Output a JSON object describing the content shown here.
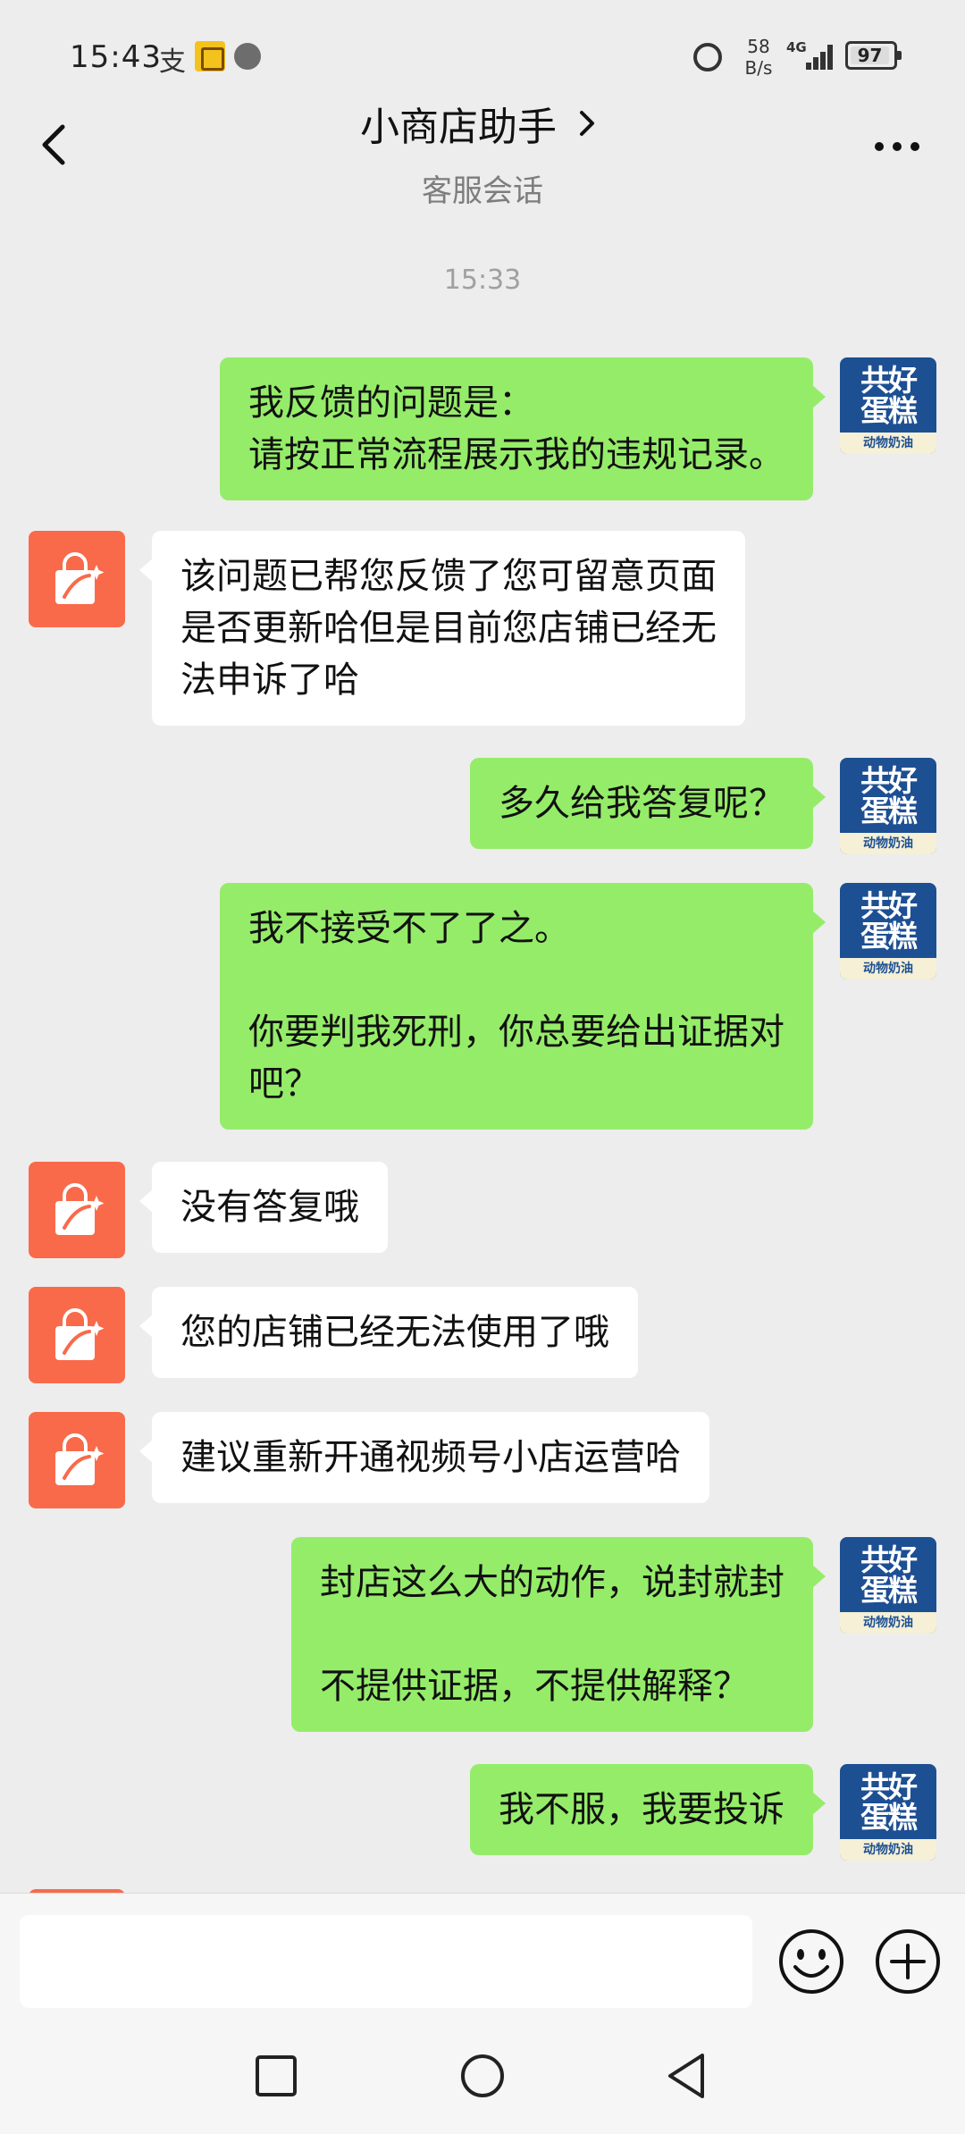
{
  "status_bar": {
    "time": "15:43",
    "alipay_glyph": "支",
    "net_speed_value": "58",
    "net_speed_unit": "B/s",
    "network_type": "4G",
    "battery": "97",
    "icons": [
      "alipay-icon",
      "app-badge-icon",
      "voice-icon",
      "alarm-icon",
      "signal-icon",
      "battery-icon"
    ]
  },
  "header": {
    "title": "小商店助手",
    "subtitle": "客服会话",
    "icons": [
      "back-arrow-icon",
      "chevron-right-icon",
      "more-dots-icon"
    ]
  },
  "chat": {
    "timestamp": "15:33",
    "messages": [
      {
        "sender": "user",
        "text": "我反馈的问题是：\n请按正常流程展示我的违规记录。"
      },
      {
        "sender": "bot",
        "text": "该问题已帮您反馈了您可留意页面\n是否更新哈但是目前您店铺已经无\n法申诉了哈"
      },
      {
        "sender": "user",
        "text": "多久给我答复呢？"
      },
      {
        "sender": "user",
        "text": "我不接受不了了之。\n\n你要判我死刑，你总要给出证据对\n吧？"
      },
      {
        "sender": "bot",
        "text": "没有答复哦"
      },
      {
        "sender": "bot",
        "text": "您的店铺已经无法使用了哦"
      },
      {
        "sender": "bot",
        "text": "建议重新开通视频号小店运营哈"
      },
      {
        "sender": "user",
        "text": "封店这么大的动作，说封就封\n\n不提供证据，不提供解释？"
      },
      {
        "sender": "user",
        "text": "我不服，我要投诉"
      }
    ],
    "user_avatar": {
      "line1": "共好",
      "line2": "蛋糕",
      "ribbon": "动物奶油"
    },
    "bot_avatar_icon": "shopping-bag-icon"
  },
  "input_bar": {
    "placeholder": "",
    "icons": [
      "emoji-icon",
      "plus-icon"
    ]
  },
  "nav_bar": {
    "icons": [
      "recent-apps-icon",
      "home-icon",
      "back-triangle-icon"
    ]
  },
  "colors": {
    "background": "#ededed",
    "user_bubble": "#95ec69",
    "bot_bubble": "#ffffff",
    "bot_avatar": "#f96a4b",
    "user_avatar": "#1d4f93"
  }
}
